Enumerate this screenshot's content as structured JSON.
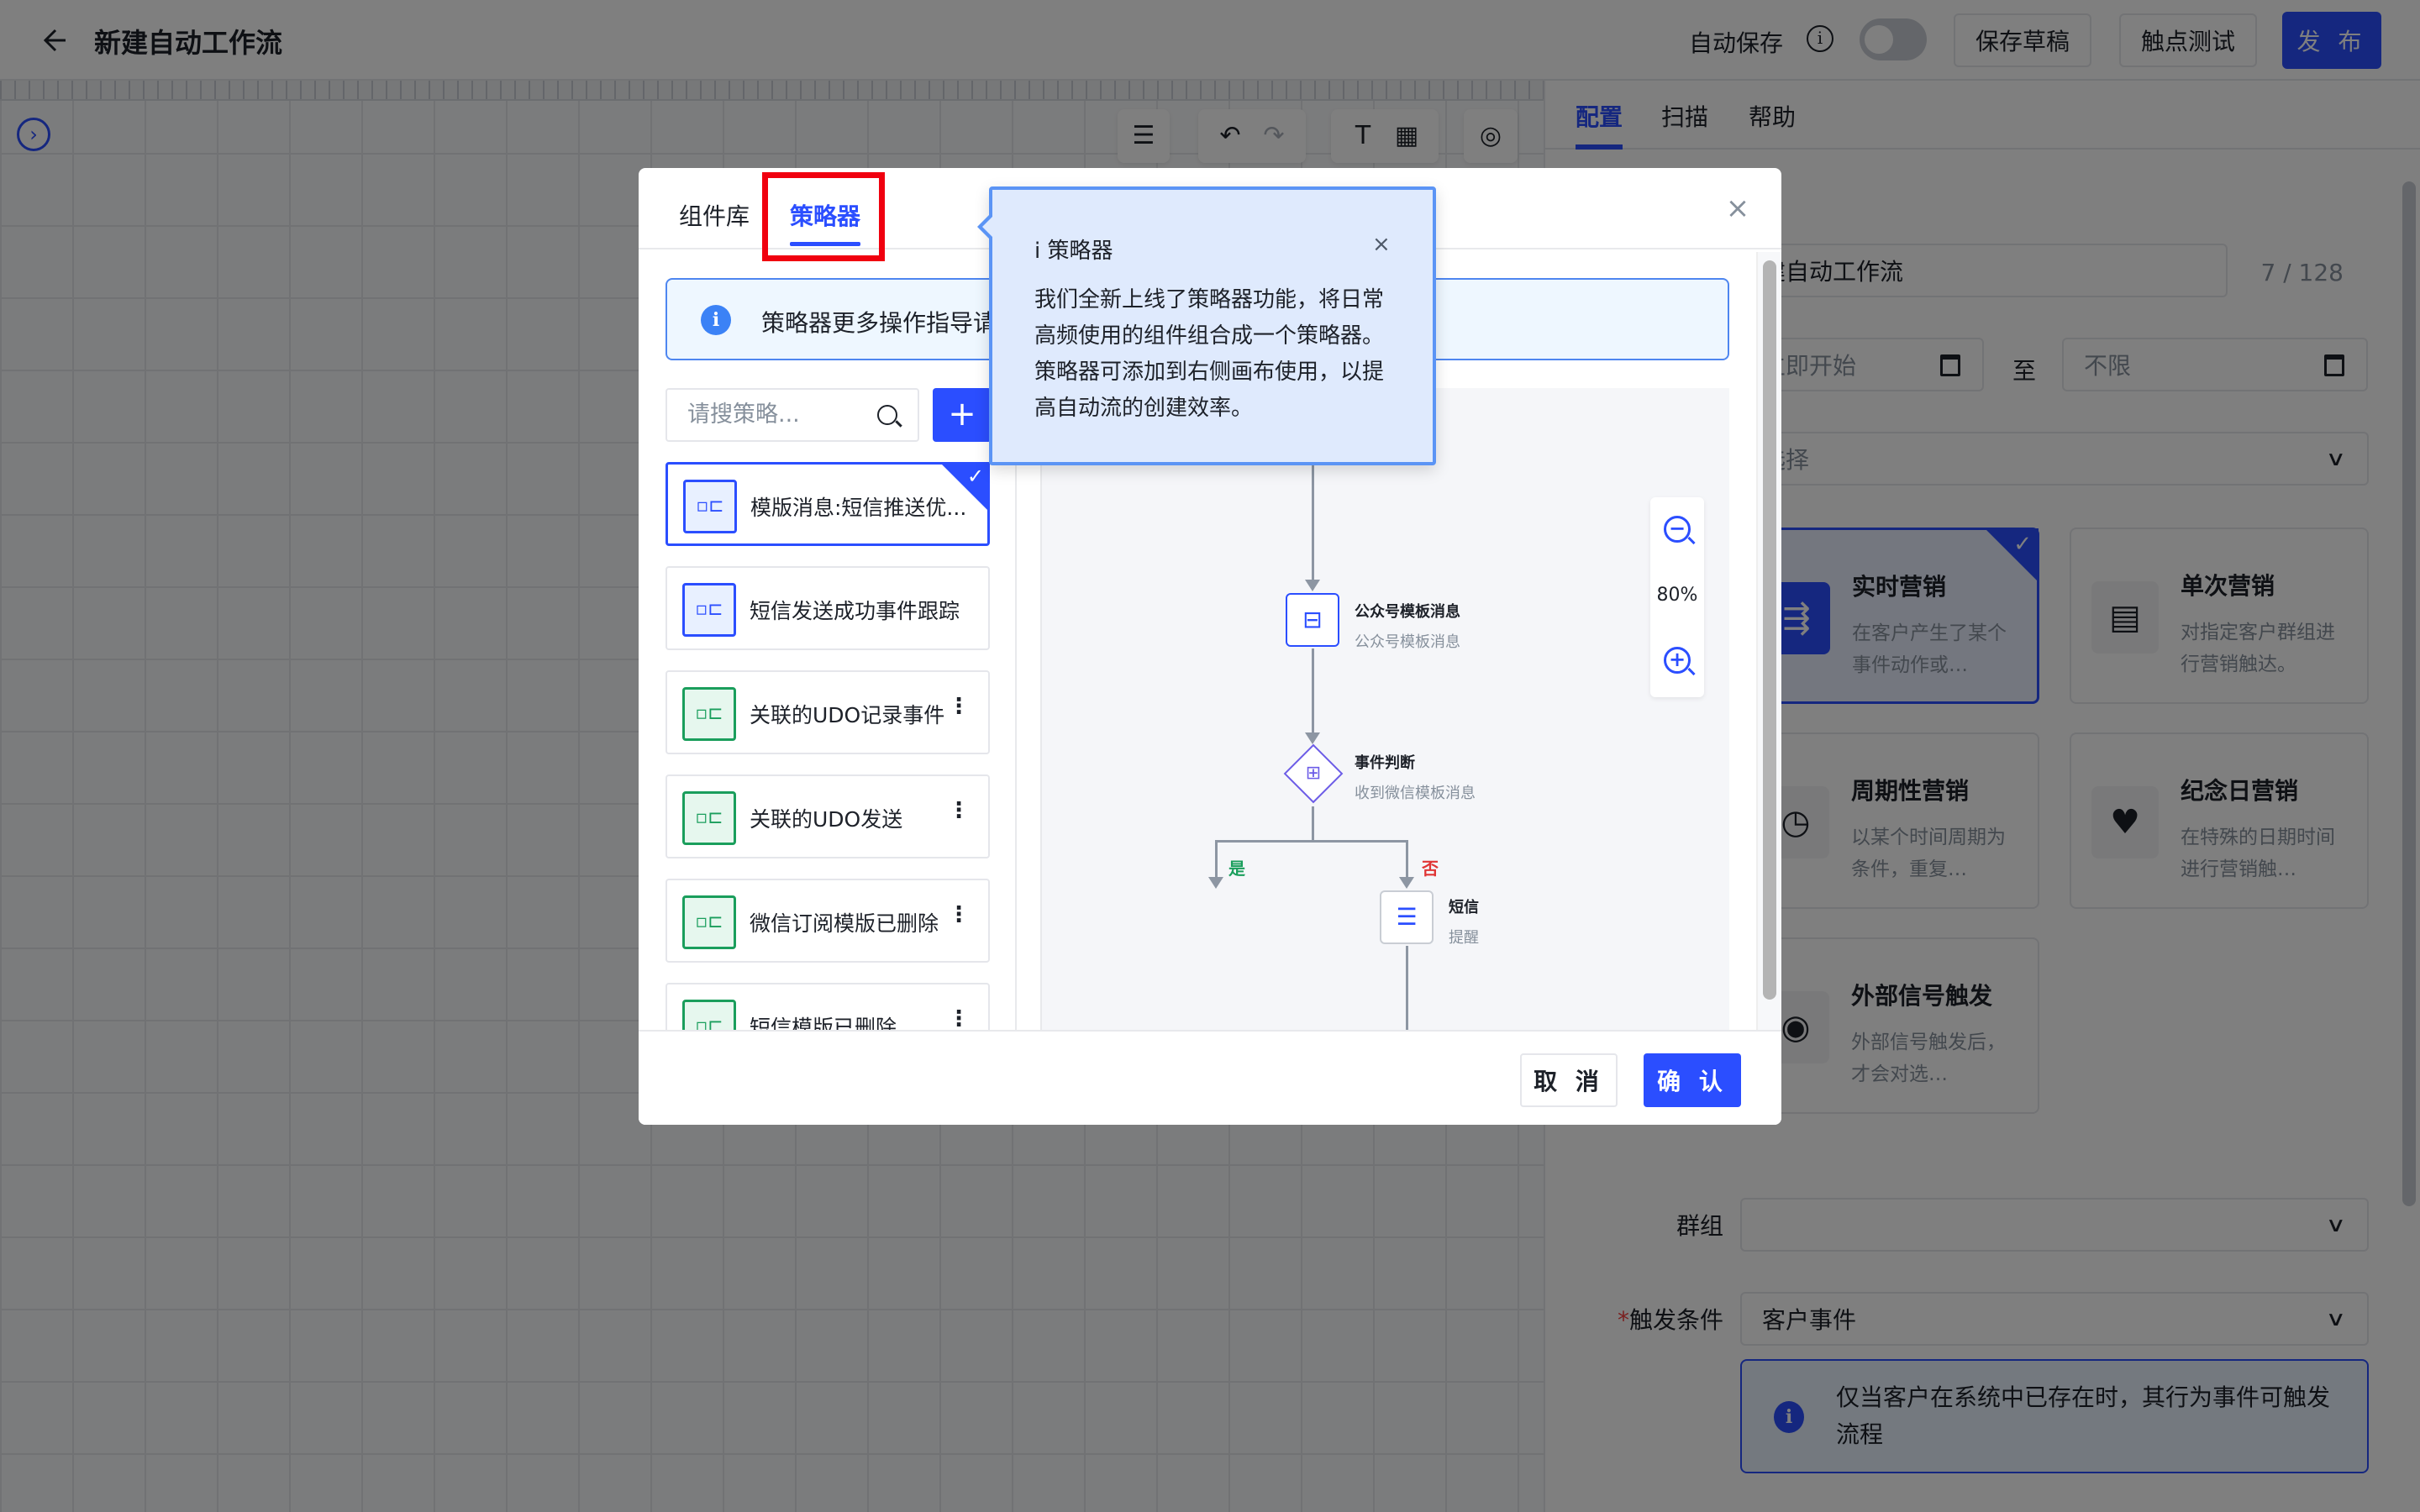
{
  "header": {
    "title": "新建自动工作流",
    "autosave_label": "自动保存",
    "autosave_enabled": false,
    "save_draft": "保存草稿",
    "touch_test": "触点测试",
    "publish": "发 布"
  },
  "canvas": {
    "toolbar": [
      "document-icon",
      "undo-icon",
      "redo-icon",
      "text-icon",
      "grid-icon",
      "user-locate-icon"
    ]
  },
  "right_panel": {
    "tabs": [
      {
        "label": "配置",
        "active": true
      },
      {
        "label": "扫描",
        "active": false
      },
      {
        "label": "帮助",
        "active": false
      }
    ],
    "name_value": "新建自动工作流",
    "name_visible": "建自动工作流",
    "name_count": "7 / 128",
    "start_placeholder": "立即开始",
    "start_visible": "立即开始",
    "to_label": "至",
    "end_placeholder": "不限",
    "select_placeholder": "选择",
    "types": [
      {
        "title": "实时营销",
        "desc": "在客户产生了某个事件动作或…",
        "selected": true
      },
      {
        "title": "单次营销",
        "desc": "对指定客户群组进行营销触达。",
        "selected": false
      },
      {
        "title": "周期性营销",
        "desc": "以某个时间周期为条件，重复…",
        "selected": false
      },
      {
        "title": "纪念日营销",
        "desc": "在特殊的日期时间进行营销触…",
        "selected": false
      },
      {
        "title": "外部信号触发",
        "desc": "外部信号触发后，才会对选…",
        "selected": false
      }
    ],
    "group_label": "群组",
    "group_value": "",
    "trigger_label": "触发条件",
    "trigger_required": "*",
    "trigger_value": "客户事件",
    "trigger_notice": "仅当客户在系统中已存在时，其行为事件可触发流程"
  },
  "modal": {
    "tabs": [
      {
        "label": "组件库",
        "active": false
      },
      {
        "label": "策略器",
        "active": true
      }
    ],
    "close_label": "×",
    "notice": "策略器更多操作指导请",
    "search_placeholder": "请搜策略...",
    "add_label": "+",
    "strategies": [
      {
        "label": "模版消息:短信推送优...",
        "color": "blue",
        "selected": true,
        "has_more": false
      },
      {
        "label": "短信发送成功事件跟踪",
        "color": "blue",
        "selected": false,
        "has_more": false
      },
      {
        "label": "关联的UDO记录事件",
        "color": "green",
        "selected": false,
        "has_more": true
      },
      {
        "label": "关联的UDO发送",
        "color": "green",
        "selected": false,
        "has_more": true
      },
      {
        "label": "微信订阅模版已删除",
        "color": "green",
        "selected": false,
        "has_more": true
      },
      {
        "label": "短信模版已删除",
        "color": "green",
        "selected": false,
        "has_more": true
      }
    ],
    "preview": {
      "zoom_level": "80%",
      "nodes": [
        {
          "title": "公众号模板消息",
          "subtitle": "公众号模板消息"
        },
        {
          "title": "事件判断",
          "subtitle": "收到微信模板消息"
        },
        {
          "title": "短信",
          "subtitle": "提醒"
        }
      ],
      "branch_yes": "是",
      "branch_no": "否"
    },
    "cancel": "取 消",
    "confirm": "确 认"
  },
  "popover": {
    "title": "i 策略器",
    "body": "我们全新上线了策略器功能，将日常高频使用的组件组合成一个策略器。策略器可添加到右侧画布使用，以提高自动流的创建效率。",
    "close_label": "×"
  },
  "colors": {
    "primary": "#2b4eff",
    "highlight": "#f0000f",
    "success": "#1a9e5c",
    "danger": "#e03535",
    "popover_bg": "#dfeafd"
  }
}
